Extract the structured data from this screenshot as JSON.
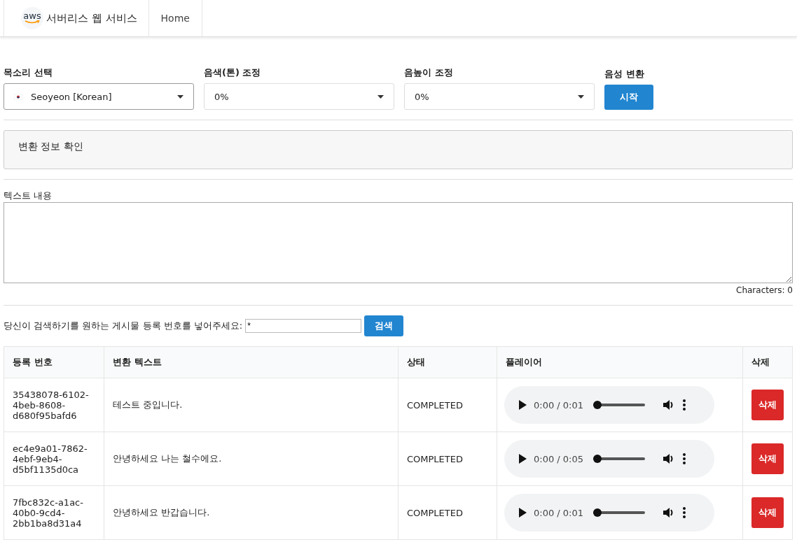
{
  "navbar": {
    "brand": {
      "logo_text": "aws",
      "title": "서버리스 웹 서비스"
    },
    "links": [
      {
        "label": "Home",
        "selected": false
      }
    ]
  },
  "controls": [
    {
      "kind": "select",
      "label": "목소리 선택",
      "value": "Seoyeon [Korean]",
      "flag": true
    },
    {
      "kind": "select",
      "label": "음색(톤) 조정",
      "value": "0%",
      "flag": false
    },
    {
      "kind": "select",
      "label": "음높이 조정",
      "value": "0%",
      "flag": false
    },
    {
      "kind": "button",
      "label": "음성 변환",
      "value": "시작"
    }
  ],
  "info_panel": {
    "title": "변환 정보 확인"
  },
  "text_content": {
    "label": "텍스트 내용",
    "counter": "Characters: 0"
  },
  "search": {
    "label": "당신이 검색하기를 원하는 게시물 등록 번호를 넣어주세요:",
    "value": "*",
    "button": "검색"
  },
  "table": {
    "columns": [
      "등록 번호",
      "변환 텍스트",
      "상태",
      "플레이어",
      "삭제"
    ],
    "rows": [
      {
        "id": "35438078-6102-4beb-8608-d680f95bafd6",
        "text": "테스트 중입니다.",
        "status": "COMPLETED",
        "player": {
          "time": "0:00 / 0:01",
          "level": 0
        },
        "delete": "삭제"
      },
      {
        "id": "ec4e9a01-7862-4ebf-9eb4-d5bf1135d0ca",
        "text": "안녕하세요 나는 철수에요.",
        "status": "COMPLETED",
        "player": {
          "time": "0:00 / 0:05",
          "level": 0
        },
        "delete": "삭제"
      },
      {
        "id": "7fbc832c-a1ac-40b0-9cd4-2bb1ba8d31a4",
        "text": "안녕하세요 반갑습니다.",
        "status": "COMPLETED",
        "player": {
          "time": "0:00 / 0:01",
          "level": 0
        },
        "delete": "삭제"
      }
    ]
  }
}
